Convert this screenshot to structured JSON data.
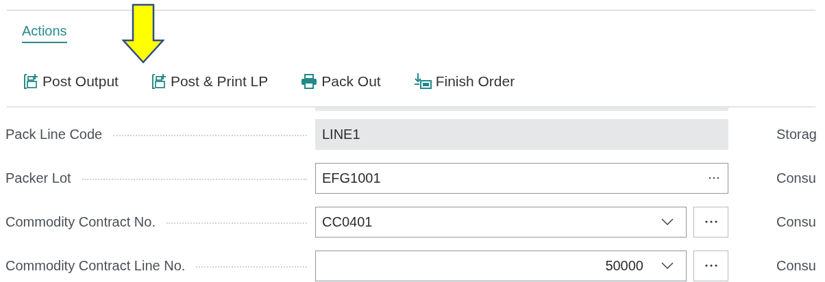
{
  "tabs": [
    {
      "label": "Actions",
      "selected": true
    }
  ],
  "actions": [
    {
      "label": "Post Output",
      "kind": "post"
    },
    {
      "label": "Post & Print LP",
      "kind": "post"
    },
    {
      "label": "Pack Out",
      "kind": "print"
    },
    {
      "label": "Finish Order",
      "kind": "finish"
    }
  ],
  "fields": [
    {
      "label": "Pack Line Code",
      "value": "LINE1",
      "kind": "readonly",
      "side_label": "Storag"
    },
    {
      "label": "Packer Lot",
      "value": "EFG1001",
      "kind": "lookup",
      "side_label": "Consu"
    },
    {
      "label": "Commodity Contract No.",
      "value": "CC0401",
      "kind": "dropdown",
      "side_label": "Consu"
    },
    {
      "label": "Commodity Contract Line No.",
      "value": "50000",
      "kind": "number-dropdown",
      "side_label": "Consu"
    }
  ]
}
